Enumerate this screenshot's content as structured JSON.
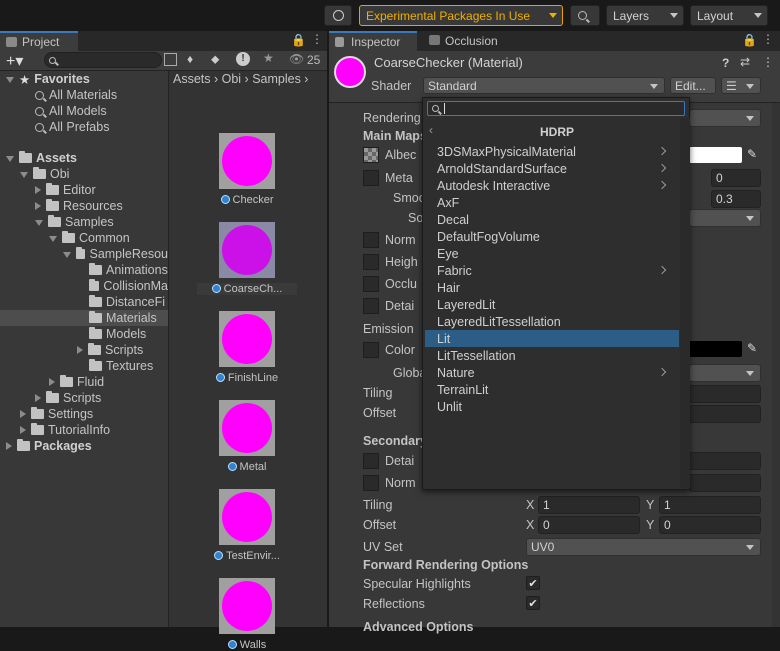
{
  "toolbar": {
    "experimental": "Experimental Packages In Use",
    "layers": "Layers",
    "layout": "Layout"
  },
  "project": {
    "tab": "Project",
    "eye_count": "25",
    "breadcrumb": [
      "Assets",
      "Obi",
      "Samples"
    ],
    "favorites": {
      "label": "Favorites",
      "items": [
        "All Materials",
        "All Models",
        "All Prefabs"
      ]
    },
    "tree": {
      "assets": "Assets",
      "obi": "Obi",
      "editor": "Editor",
      "resources": "Resources",
      "samples": "Samples",
      "common": "Common",
      "sampleres": "SampleResou",
      "animations": "Animations",
      "collision": "CollisionMa",
      "distance": "DistanceFi",
      "materials": "Materials",
      "models": "Models",
      "scripts_inner": "Scripts",
      "textures": "Textures",
      "fluid": "Fluid",
      "scripts": "Scripts",
      "settings": "Settings",
      "tutorial": "TutorialInfo",
      "packages": "Packages"
    },
    "assets": [
      "Checker",
      "CoarseCh...",
      "FinishLine",
      "Metal",
      "TestEnvir...",
      "Walls"
    ]
  },
  "inspector": {
    "tab": "Inspector",
    "tab2": "Occlusion",
    "title": "CoarseChecker (Material)",
    "shader_label": "Shader",
    "shader_value": "Standard",
    "edit_label": "Edit...",
    "props": {
      "rendering": "Rendering",
      "mainmaps": "Main Maps",
      "albedo": "Albec",
      "metallic": "Meta",
      "smooth": "Smoo",
      "source": "So",
      "normal": "Norm",
      "height": "Heigh",
      "occlusion": "Occlu",
      "detail": "Detai",
      "emission": "Emission",
      "color": "Color",
      "global": "Globa",
      "tiling": "Tiling",
      "offset": "Offset",
      "secondary": "Secondary",
      "detail2": "Detai",
      "normal2": "Norm",
      "tiling2": "Tiling",
      "offset2": "Offset",
      "uvset": "UV Set",
      "uvset_value": "UV0",
      "forward": "Forward Rendering Options",
      "specular": "Specular Highlights",
      "reflections": "Reflections",
      "advanced": "Advanced Options",
      "metal_value": "0",
      "smooth_value": "0.3",
      "x": "X",
      "y": "Y",
      "tx": "1",
      "ty": "1",
      "ox": "0",
      "oy": "0"
    }
  },
  "shader_popup": {
    "header": "HDRP",
    "search_placeholder": "",
    "items": [
      {
        "label": "3DSMaxPhysicalMaterial",
        "sub": true
      },
      {
        "label": "ArnoldStandardSurface",
        "sub": true
      },
      {
        "label": "Autodesk Interactive",
        "sub": true
      },
      {
        "label": "AxF",
        "sub": false
      },
      {
        "label": "Decal",
        "sub": false
      },
      {
        "label": "DefaultFogVolume",
        "sub": false
      },
      {
        "label": "Eye",
        "sub": false
      },
      {
        "label": "Fabric",
        "sub": true
      },
      {
        "label": "Hair",
        "sub": false
      },
      {
        "label": "LayeredLit",
        "sub": false
      },
      {
        "label": "LayeredLitTessellation",
        "sub": false
      },
      {
        "label": "Lit",
        "sub": false
      },
      {
        "label": "LitTessellation",
        "sub": false
      },
      {
        "label": "Nature",
        "sub": true
      },
      {
        "label": "TerrainLit",
        "sub": false
      },
      {
        "label": "Unlit",
        "sub": false
      }
    ],
    "selected": "Lit"
  },
  "colors": {
    "accent": "#2c5d87",
    "warning": "#f0b000",
    "thumb": "#ff00ff"
  }
}
